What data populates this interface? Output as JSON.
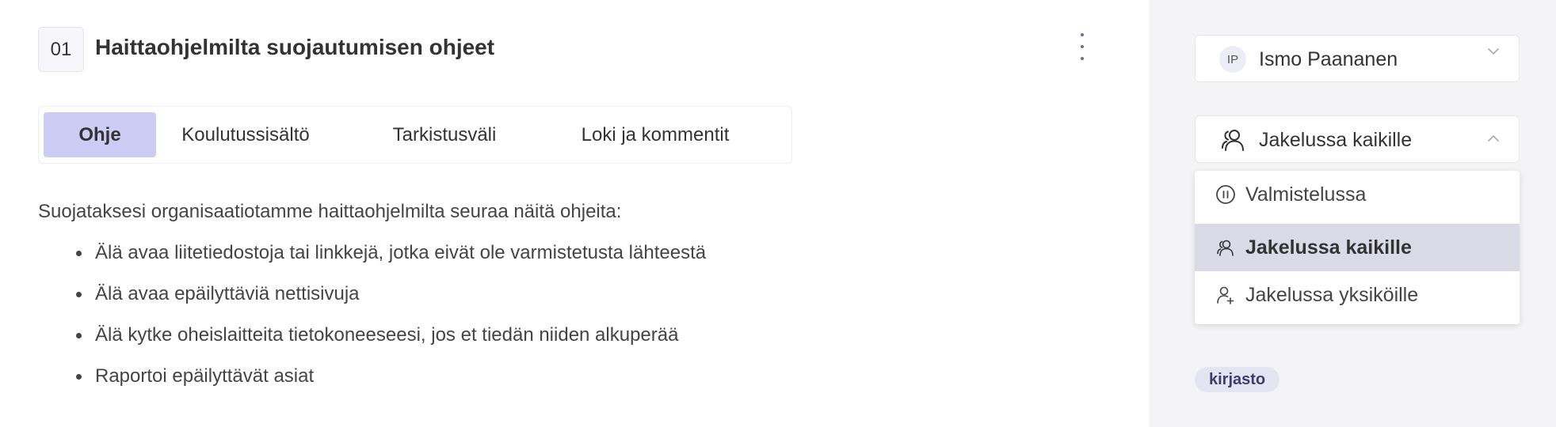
{
  "header": {
    "number": "01",
    "title": "Haittaohjelmilta suojautumisen ohjeet",
    "menu_icon": "kebab-vertical-icon"
  },
  "tabs": [
    {
      "label": "Ohje",
      "active": true
    },
    {
      "label": "Koulutussisältö",
      "active": false
    },
    {
      "label": "Tarkistusväli",
      "active": false
    },
    {
      "label": "Loki ja kommentit",
      "active": false
    }
  ],
  "content": {
    "intro": "Suojataksesi organisaatiotamme haittaohjelmilta seuraa näitä ohjeita:",
    "bullets": [
      "Älä avaa liitetiedostoja tai linkkejä, jotka eivät ole varmistetusta lähteestä",
      "Älä avaa epäilyttäviä nettisivuja",
      "Älä kytke oheislaitteita tietokoneeseesi, jos et tiedän niiden alkuperää",
      "Raportoi epäilyttävät asiat"
    ]
  },
  "sidebar": {
    "owner": {
      "initials": "IP",
      "name": "Ismo Paananen",
      "icon": "chevron-down-icon"
    },
    "status": {
      "selected": "Jakelussa kaikille",
      "icon": "users-icon",
      "toggle_icon": "chevron-up-icon"
    },
    "status_options": [
      {
        "label": "Valmistelussa",
        "icon": "pause-circle-icon",
        "selected": false
      },
      {
        "label": "Jakelussa kaikille",
        "icon": "users-icon",
        "selected": true
      },
      {
        "label": "Jakelussa yksiköille",
        "icon": "user-plus-icon",
        "selected": false
      }
    ],
    "tag": "kirjasto"
  },
  "colors": {
    "accent_tab": "#ccccf4",
    "sidebar_bg": "#f4f4f6",
    "selected_option": "#dadbe7",
    "tag_bg": "#e4e5f3",
    "kebab": "#6b6bb0"
  }
}
